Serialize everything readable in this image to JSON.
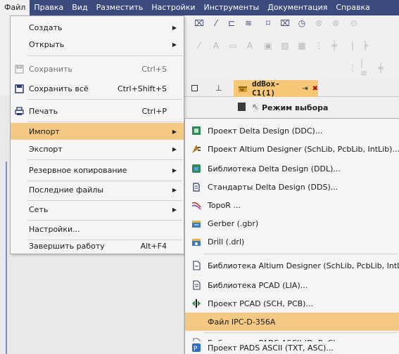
{
  "menubar": {
    "items": [
      "Файл",
      "Правка",
      "Вид",
      "Разместить",
      "Настройки",
      "Инструменты",
      "Документация",
      "Справка"
    ]
  },
  "document_tab": {
    "label": "ddBox-C1(1)",
    "pin": "⇥",
    "close": "✖"
  },
  "mode_bar": {
    "label": "Режим выбора"
  },
  "file_menu": {
    "items": [
      {
        "label": "Создать",
        "shortcut": "",
        "submenu": true,
        "disabled": false,
        "icon": ""
      },
      {
        "label": "Открыть",
        "shortcut": "",
        "submenu": true,
        "disabled": false,
        "icon": ""
      },
      {
        "label": "Сохранить",
        "shortcut": "Ctrl+S",
        "submenu": false,
        "disabled": true,
        "icon": "save-icon"
      },
      {
        "label": "Сохранить всё",
        "shortcut": "Ctrl+Shift+S",
        "submenu": false,
        "disabled": false,
        "icon": "save-all-icon"
      },
      {
        "label": "Печать",
        "shortcut": "Ctrl+P",
        "submenu": false,
        "disabled": false,
        "icon": "print-icon"
      },
      {
        "label": "Импорт",
        "shortcut": "",
        "submenu": true,
        "disabled": false,
        "icon": "",
        "highlighted": true
      },
      {
        "label": "Экспорт",
        "shortcut": "",
        "submenu": true,
        "disabled": false,
        "icon": ""
      },
      {
        "label": "Резервное копирование",
        "shortcut": "",
        "submenu": true,
        "disabled": false,
        "icon": ""
      },
      {
        "label": "Последние файлы",
        "shortcut": "",
        "submenu": true,
        "disabled": false,
        "icon": ""
      },
      {
        "label": "Сеть",
        "shortcut": "",
        "submenu": true,
        "disabled": false,
        "icon": ""
      },
      {
        "label": "Настройки...",
        "shortcut": "",
        "submenu": false,
        "disabled": false,
        "icon": ""
      },
      {
        "label": "Завершить работу",
        "shortcut": "Alt+F4",
        "submenu": false,
        "disabled": false,
        "icon": ""
      }
    ]
  },
  "import_menu": {
    "items": [
      {
        "label": "Проект Delta Design (DDC)...",
        "icon": "delta-project-icon"
      },
      {
        "label": "Проект Altium Designer (SchLib, PcbLib, IntLib)...",
        "icon": "altium-icon"
      },
      {
        "label": "Библиотека Delta Design (DDL)...",
        "icon": "delta-library-icon"
      },
      {
        "label": "Стандарты Delta Design (DDS)...",
        "icon": "standards-icon"
      },
      {
        "label": "TopoR ...",
        "icon": "topor-icon"
      },
      {
        "label": "Gerber (.gbr)",
        "icon": "gerber-icon"
      },
      {
        "label": "Drill (.drl)",
        "icon": "drill-icon"
      },
      {
        "label": "Библиотека Altium Designer (SchLib, PcbLib, IntLib)...",
        "icon": "altium-library-icon"
      },
      {
        "label": "Библиотека PCAD (LIA)...",
        "icon": "pcad-library-icon"
      },
      {
        "label": "Проект PCAD (SCH, PCB)...",
        "icon": "pcad-project-icon"
      },
      {
        "label": "Файл IPC-D-356A",
        "icon": "",
        "highlighted": true
      },
      {
        "label": "Библиотека PADS ASCII (D, P, C)...",
        "icon": "pads-library-icon"
      },
      {
        "label": "Проект PADS ASCII (TXT, ASC)...",
        "icon": "pads-project-icon"
      }
    ]
  },
  "colors": {
    "menubar": "#3c4a7e",
    "highlight": "#f4c983",
    "tab_active": "#f5c777"
  }
}
